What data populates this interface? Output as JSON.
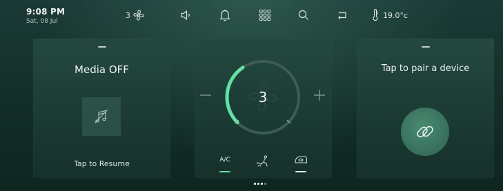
{
  "status_bar": {
    "time": "9:08 PM",
    "date": "Sat, 08 Jul",
    "fan_level": "3",
    "temperature": "19.0°c"
  },
  "icons": {
    "fan": "fan-icon",
    "sound": "speaker-icon",
    "notifications": "bell-icon",
    "apps": "apps-grid-icon",
    "search": "search-icon",
    "back": "back-arrow-icon",
    "temperature": "thermometer-icon",
    "music": "music-note-icon",
    "link": "link-icon",
    "seat": "seat-airflow-icon",
    "recirculation": "recirculation-icon"
  },
  "media_card": {
    "title": "Media OFF",
    "action": "Tap to Resume"
  },
  "climate_card": {
    "fan_speed": "3",
    "fan_speed_fraction": 0.375,
    "minus_label": "−",
    "plus_label": "+",
    "modes": {
      "ac_label": "A/C"
    }
  },
  "pair_card": {
    "title": "Tap to pair a device"
  },
  "page_indicator": {
    "pages": 4,
    "current": 1
  },
  "colors": {
    "accent": "#5fe3a5",
    "background": "#143029",
    "card": "#1f4139"
  }
}
